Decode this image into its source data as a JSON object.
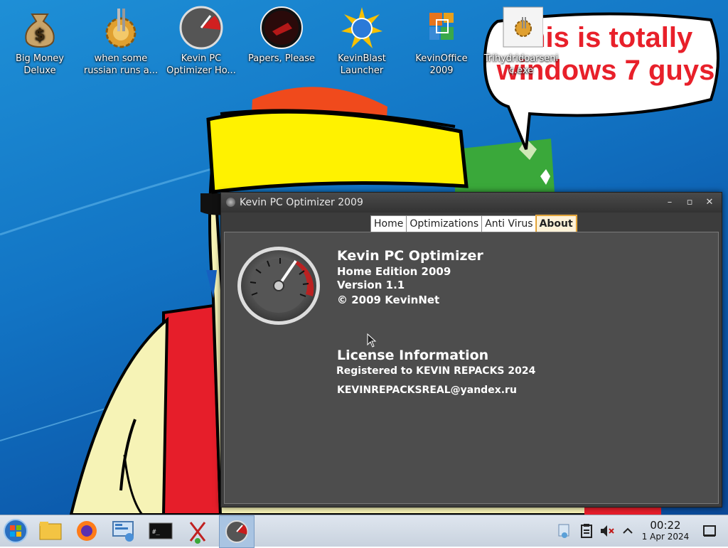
{
  "desktop": {
    "icons": [
      {
        "label": "Big Money\nDeluxe",
        "icon": "money-bag-icon"
      },
      {
        "label": "when some\nrussian runs a...",
        "icon": "gear-icon"
      },
      {
        "label": "Kevin PC\nOptimizer Ho...",
        "icon": "gauge-icon"
      },
      {
        "label": "Papers, Please",
        "icon": "papers-please-icon"
      },
      {
        "label": "KevinBlast\nLauncher",
        "icon": "kevinblast-icon"
      },
      {
        "label": "KevinOffice\n2009",
        "icon": "office-icon"
      },
      {
        "label": "Trihydridoarseni\nc.exe",
        "icon": "exe-icon"
      }
    ],
    "speech_text": "this is totally windows 7 guys"
  },
  "window": {
    "title": "Kevin PC Optimizer 2009",
    "tabs": [
      "Home",
      "Optimizations",
      "Anti Virus",
      "About"
    ],
    "active_tab": "About",
    "about": {
      "product_name": "Kevin PC Optimizer",
      "edition": "Home Edition 2009",
      "version": "Version 1.1",
      "copyright": "© 2009 KevinNet",
      "license_heading": "License Information",
      "registered_to": "Registered to KEVIN REPACKS 2024",
      "email": "KEVINREPACKSREAL@yandex.ru"
    }
  },
  "taskbar": {
    "clock_time": "00:22",
    "clock_date": "1 Apr 2024"
  },
  "colors": {
    "accent_tab": "#f0b04a",
    "speech_red": "#e8202a"
  }
}
